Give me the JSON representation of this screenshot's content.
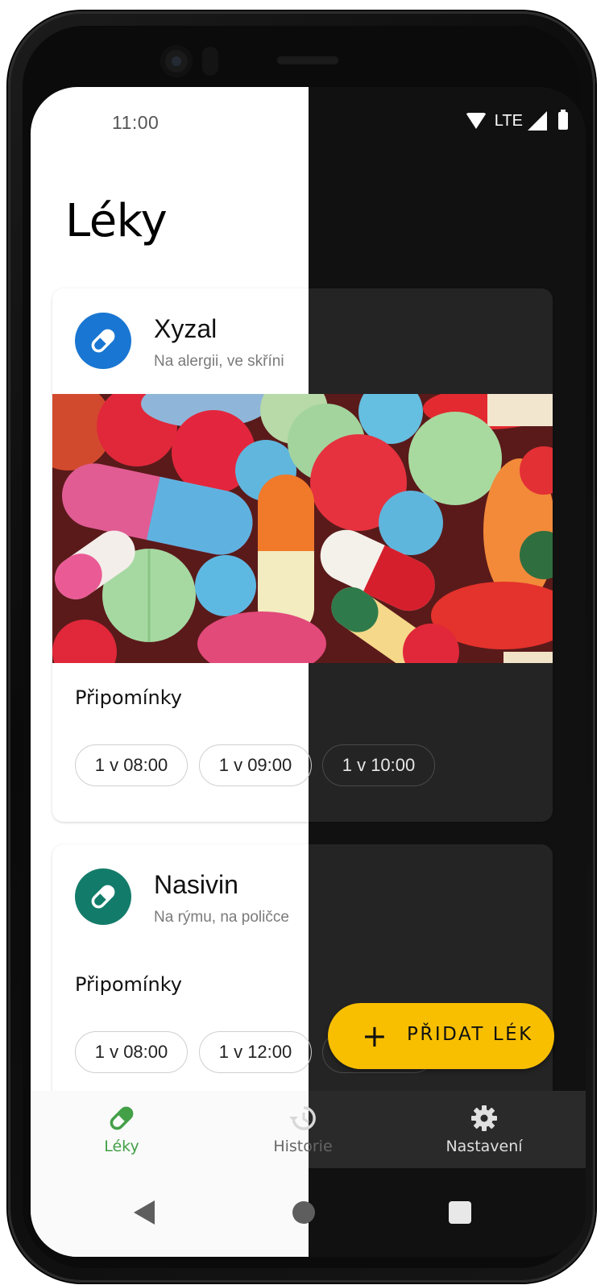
{
  "status_bar": {
    "time": "11:00",
    "network": "LTE"
  },
  "page": {
    "title": "Léky"
  },
  "medicines": [
    {
      "name": "Xyzal",
      "description": "Na alergii, ve skříni",
      "icon": "pill-icon",
      "icon_color": "#1976d2",
      "reminders_title": "Připomínky",
      "reminders": [
        "1 v 08:00",
        "1 v 09:00",
        "1 v 10:00"
      ]
    },
    {
      "name": "Nasivin",
      "description": "Na rýmu, na poličce",
      "icon": "pill-icon",
      "icon_color": "#137b6a",
      "reminders_title": "Připomínky",
      "reminders": [
        "1 v 08:00",
        "1 v 12:00"
      ]
    }
  ],
  "fab": {
    "label": "PŘIDAT LÉK",
    "icon": "plus-icon",
    "color": "#f8bf00"
  },
  "bottom_nav": [
    {
      "label": "Léky",
      "icon": "pill-icon",
      "active": true,
      "color": "#43a047"
    },
    {
      "label": "Historie",
      "icon": "history-icon",
      "active": false
    },
    {
      "label": "Nastavení",
      "icon": "gear-icon",
      "active": false
    }
  ],
  "system_nav": [
    "back-icon",
    "home-icon",
    "recents-icon"
  ]
}
